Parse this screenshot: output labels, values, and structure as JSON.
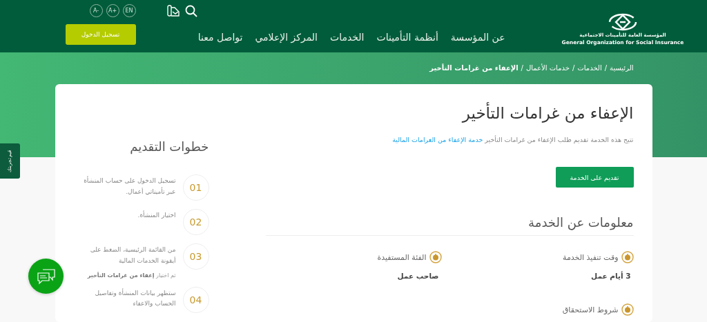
{
  "header": {
    "logo": {
      "name_ar": "المؤسسة العامة للتأمينات الاجتماعية",
      "name_en": "General Organization for Social Insurance"
    },
    "nav": [
      "عن المؤسسة",
      "أنظمة التأمينات",
      "الخدمات",
      "المركز الإعلامي",
      "تواصل معنا"
    ],
    "font_controls": [
      "EN",
      "A+",
      "A-"
    ],
    "login_button": "تسجيل الدخول"
  },
  "breadcrumb": [
    {
      "kind": "link",
      "label": "الرئيسية",
      "current": false
    },
    {
      "kind": "separator",
      "label": "/"
    },
    {
      "kind": "link",
      "label": "الخدمات",
      "current": false
    },
    {
      "kind": "separator",
      "label": "/"
    },
    {
      "kind": "link",
      "label": "خدمات الأعمال",
      "current": false
    },
    {
      "kind": "separator",
      "label": "/"
    },
    {
      "kind": "link",
      "label": "الإعفاء من غرامات التأخير",
      "current": true
    }
  ],
  "service": {
    "title": "الإعفاء من غرامات التأخير",
    "description": "تتيح هذه الخدمة تقديم طلب الإعفاء من غرامات التأخير",
    "description_link": "خدمة الإعفاء من الغرامات المالية",
    "apply_button": "تقديم على الخدمة",
    "info_title": "معلومات عن الخدمة",
    "info": [
      {
        "label": "وقت تنفيذ الخدمة",
        "value": "3 أيام عمل"
      },
      {
        "label": "الفئة المستفيدة",
        "value": "صاحب عمل"
      },
      {
        "label": "شروط الاستحقاق"
      }
    ]
  },
  "steps": {
    "title": "خطوات التقديم",
    "items": [
      {
        "number": "01",
        "text": "تسجيل الدخول على حساب المنشأة عبر تأميناتي أعمال."
      },
      {
        "number": "02",
        "text": "اختيار المنشأة."
      },
      {
        "number": "03",
        "text": "من القائمة الرئيسية، الضغط على أيقونة الخدمات المالية",
        "note": "ثم اختيار **إعفاء من غرامات التأخير**"
      },
      {
        "number": "04",
        "text": "ستظهر بيانات المنشأة وتفاصيل الحساب والاعفاء"
      }
    ]
  },
  "feedback_tab": "قيم تجربتك"
}
